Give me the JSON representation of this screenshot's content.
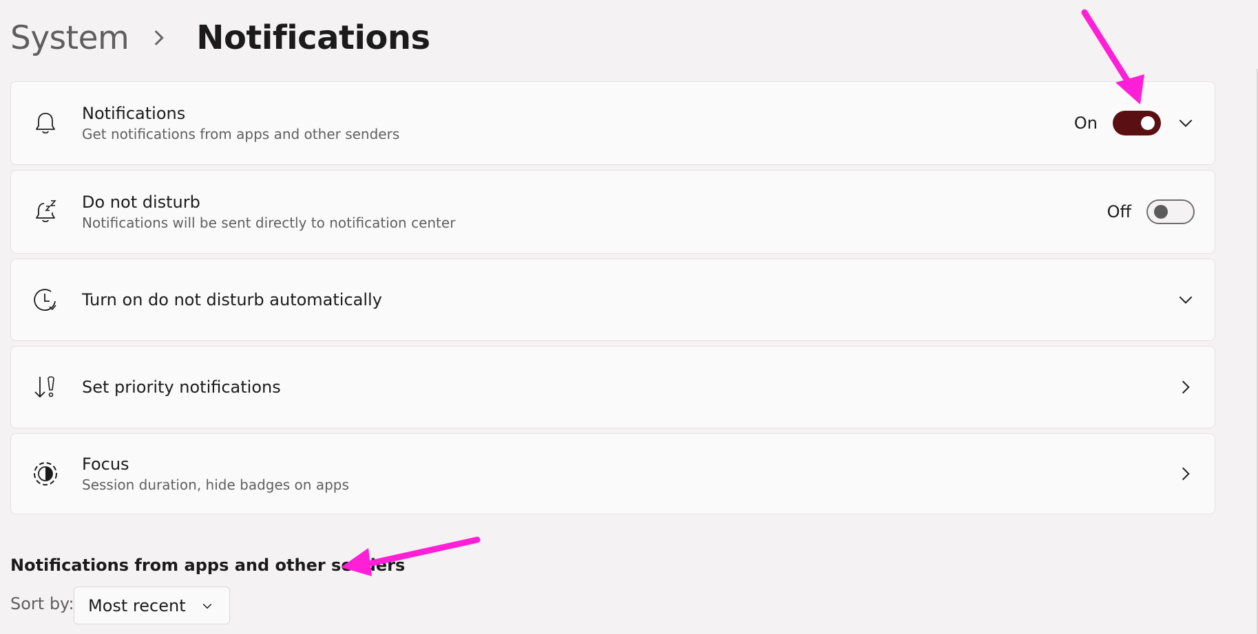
{
  "breadcrumb": {
    "parent": "System",
    "current": "Notifications"
  },
  "cards": {
    "notifications": {
      "title": "Notifications",
      "subtitle": "Get notifications from apps and other senders",
      "state_label": "On",
      "toggle_on": true,
      "icon": "bell-icon"
    },
    "dnd": {
      "title": "Do not disturb",
      "subtitle": "Notifications will be sent directly to notification center",
      "state_label": "Off",
      "toggle_on": false,
      "icon": "bell-snooze-icon"
    },
    "auto_dnd": {
      "title": "Turn on do not disturb automatically",
      "icon": "clock-icon"
    },
    "priority": {
      "title": "Set priority notifications",
      "icon": "priority-icon"
    },
    "focus": {
      "title": "Focus",
      "subtitle": "Session duration, hide badges on apps",
      "icon": "focus-icon"
    }
  },
  "section": {
    "heading": "Notifications from apps and other senders"
  },
  "sort": {
    "label": "Sort by:",
    "value": "Most recent"
  },
  "colors": {
    "accent": "#5a0f12",
    "annotation": "#ff1fd6",
    "background": "#f4f2f3",
    "card": "#fbfafa"
  }
}
